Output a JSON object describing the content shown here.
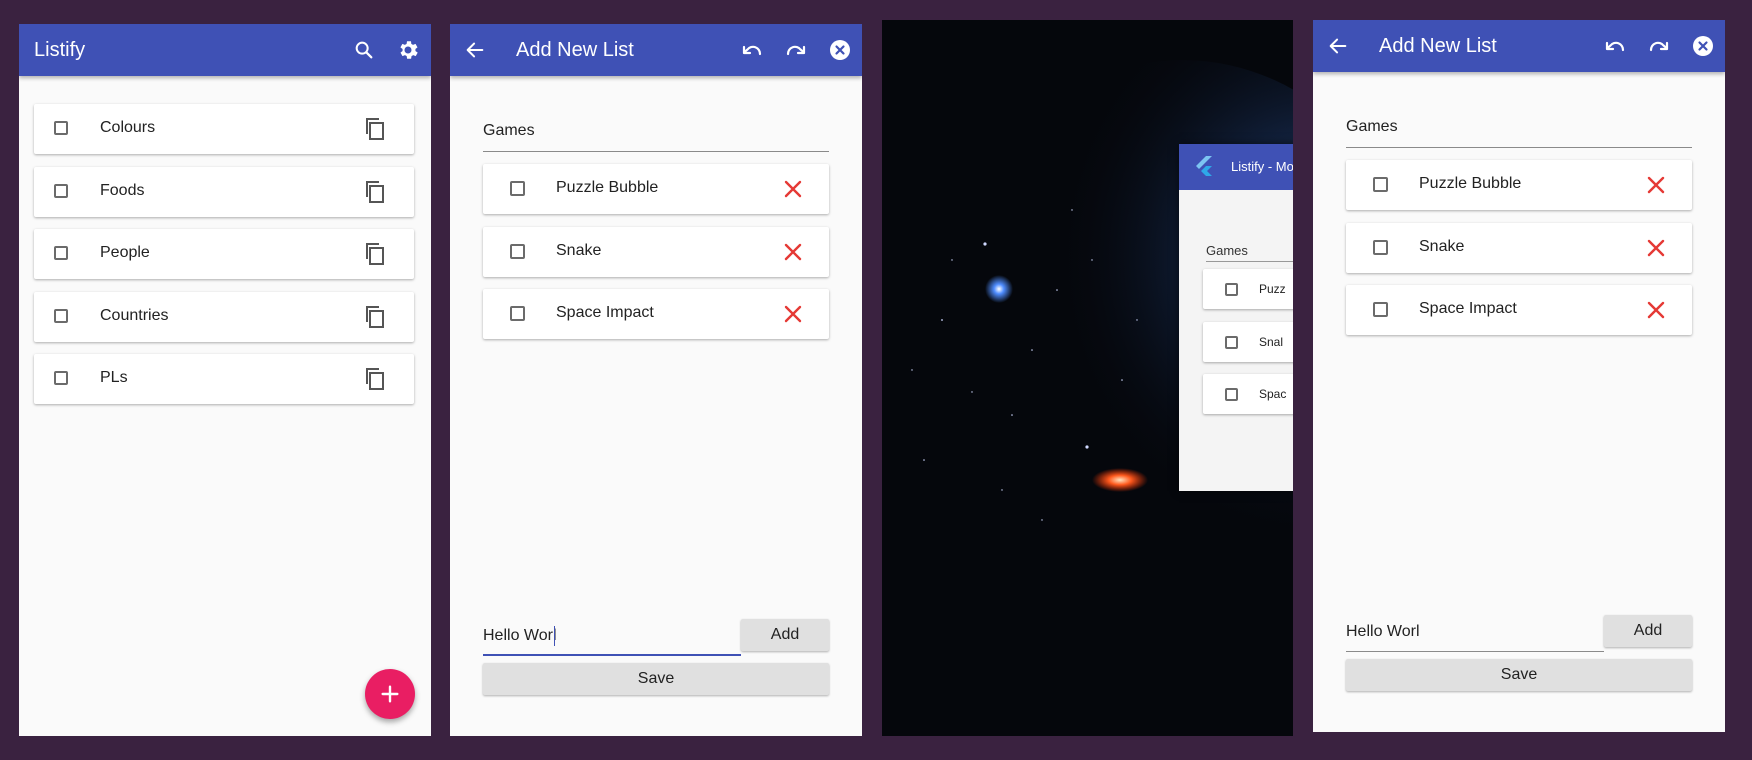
{
  "colors": {
    "appbar": "#3f51b5",
    "delete": "#e53935",
    "fab": "#e91e63",
    "accent_underline": "#3f51b5",
    "background": "#3a2240"
  },
  "home": {
    "title": "Listify",
    "icons": [
      "search-icon",
      "gear-icon",
      "copy-icon",
      "plus-icon"
    ],
    "lists": [
      {
        "label": "Colours"
      },
      {
        "label": "Foods"
      },
      {
        "label": "People"
      },
      {
        "label": "Countries"
      },
      {
        "label": "PLs"
      }
    ]
  },
  "add_list": {
    "title": "Add New List",
    "name_value": "Games",
    "items": [
      {
        "label": "Puzzle Bubble"
      },
      {
        "label": "Snake"
      },
      {
        "label": "Space Impact"
      }
    ],
    "new_item_value": "Hello Worl",
    "add_label": "Add",
    "save_label": "Save"
  },
  "window_preview": {
    "title": "Listify - Mo",
    "field_value": "Games",
    "items": [
      "Puzz",
      "Snal",
      "Spac"
    ]
  }
}
